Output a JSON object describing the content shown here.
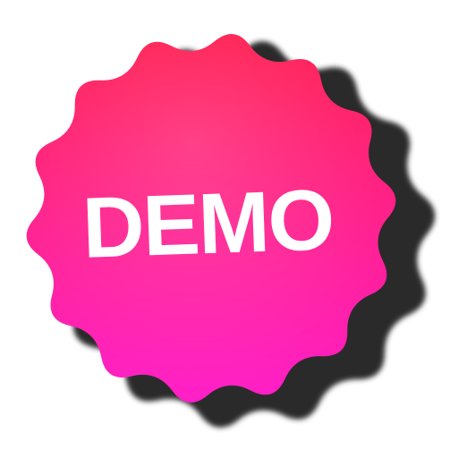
{
  "badge": {
    "label": "DEMO",
    "icon": "demo-starburst-badge-icon",
    "colors": {
      "gradient_top": "#ff1247",
      "gradient_bottom": "#ff1fc9",
      "shadow": "#2a2a2a",
      "text": "#ffffff",
      "background": "#ffffff"
    }
  }
}
